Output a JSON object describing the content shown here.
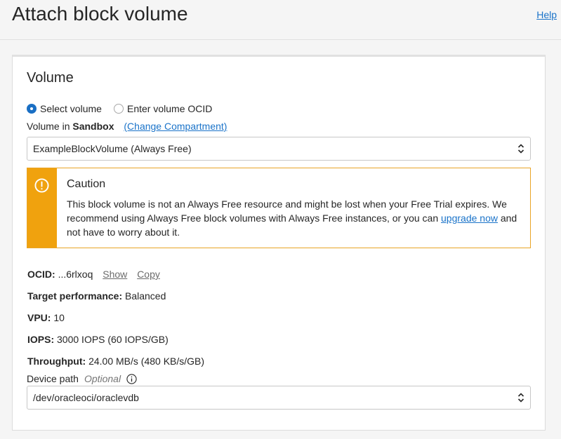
{
  "header": {
    "title": "Attach block volume",
    "help_label": "Help"
  },
  "volume": {
    "section_title": "Volume",
    "radio_select": "Select volume",
    "radio_ocid": "Enter volume OCID",
    "selected_radio": "Select volume",
    "compartment_prefix": "Volume in",
    "compartment_name": "Sandbox",
    "change_compartment": "(Change Compartment)",
    "volume_select_value": "ExampleBlockVolume (Always Free)"
  },
  "caution": {
    "title": "Caution",
    "text_before": "This block volume is not an Always Free resource and might be lost when your Free Trial expires. We recommend using Always Free block volumes with Always Free instances, or you can ",
    "link": "upgrade now",
    "text_after": " and not have to worry about it.",
    "accent_color": "#f0a20e"
  },
  "details": {
    "ocid_label": "OCID:",
    "ocid_value": "...6rlxoq",
    "show_label": "Show",
    "copy_label": "Copy",
    "perf_label": "Target performance:",
    "perf_value": "Balanced",
    "vpu_label": "VPU:",
    "vpu_value": "10",
    "iops_label": "IOPS:",
    "iops_value": "3000 IOPS (60 IOPS/GB)",
    "throughput_label": "Throughput:",
    "throughput_value": "24.00 MB/s (480 KB/s/GB)"
  },
  "device_path": {
    "label": "Device path",
    "optional": "Optional",
    "value": "/dev/oracleoci/oraclevdb"
  },
  "icons": {
    "caution": "warning-icon",
    "info": "info-icon",
    "select": "chevron-up-down-icon"
  }
}
